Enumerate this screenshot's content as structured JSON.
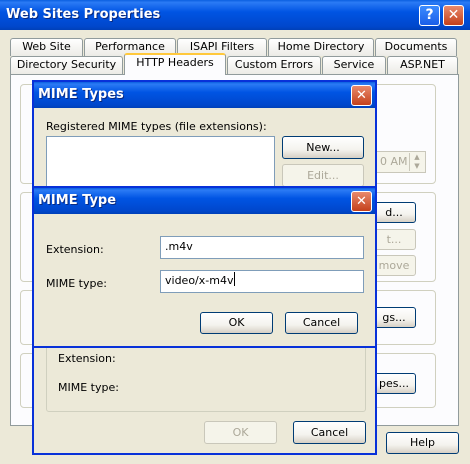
{
  "main_window": {
    "title": "Web Sites Properties",
    "help_icon": "question-mark-icon",
    "close_icon": "close-icon",
    "help_button": "Help",
    "tabs_row_back": [
      "Web Site",
      "Performance",
      "ISAPI Filters",
      "Home Directory",
      "Documents"
    ],
    "tabs_row_front": [
      "Directory Security",
      "HTTP Headers",
      "Custom Errors",
      "Service",
      "ASP.NET"
    ],
    "active_tab": "HTTP Headers",
    "partial": {
      "time_fragment": "0 AM",
      "button_1": "d...",
      "button_2": "t...",
      "button_3": "move",
      "button_4": "gs...",
      "button_5": "pes..."
    }
  },
  "mime_types_dialog": {
    "title": "MIME Types",
    "registered_label": "Registered MIME types (file extensions):",
    "new_button": "New...",
    "edit_button": "Edit...",
    "extension_label": "Extension:",
    "mime_type_label": "MIME type:",
    "ok_button": "OK",
    "cancel_button": "Cancel"
  },
  "mime_type_dialog": {
    "title": "MIME Type",
    "extension_label": "Extension:",
    "extension_value": ".m4v",
    "mime_type_label": "MIME type:",
    "mime_type_value": "video/x-m4v",
    "ok_button": "OK",
    "cancel_button": "Cancel"
  },
  "colors": {
    "titlebar_blue": "#0054E3",
    "dialog_face": "#ECE9D8",
    "close_red": "#C4401B"
  }
}
